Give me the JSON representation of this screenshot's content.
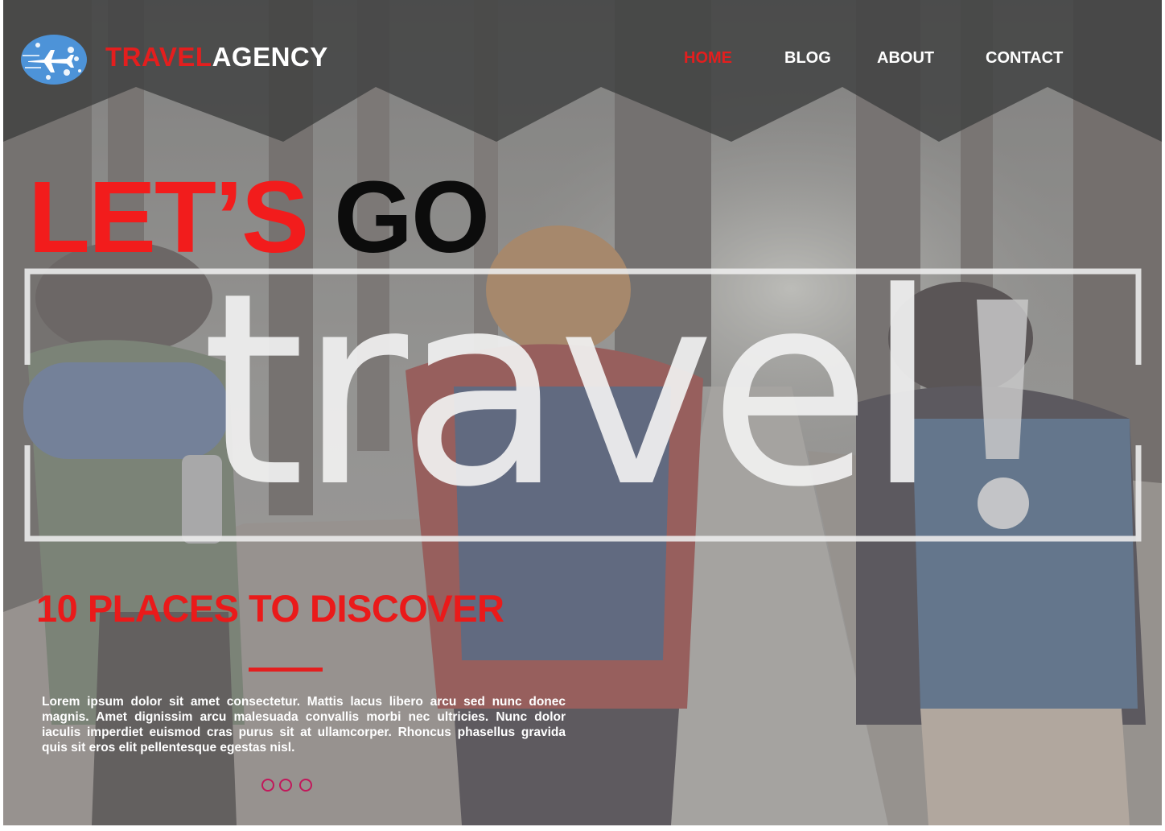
{
  "brand": {
    "part1": "TRAVEL",
    "part2": "AGENCY",
    "logo_icon": "airplane-over-globe-icon"
  },
  "nav": {
    "items": [
      {
        "label": "HOME",
        "active": true
      },
      {
        "label": "BLOG",
        "active": false
      },
      {
        "label": "ABOUT",
        "active": false
      },
      {
        "label": "CONTACT",
        "active": false
      }
    ]
  },
  "hero": {
    "headline_red": "LET’S",
    "headline_black": "GO",
    "big_word": "travel",
    "big_word_punct": "!",
    "subtitle": "10 PLACES TO DISCOVER",
    "body": "Lorem ipsum dolor sit amet consectetur. Mattis lacus libero arcu sed nunc donec magnis. Amet dignissim arcu malesuada convallis morbi nec ultricies. Nunc dolor iaculis imperdiet euismod cras purus sit at ullamcorper. Rhoncus phasellus gravida quis sit eros elit pellentesque egestas nisl."
  },
  "carousel": {
    "count": 3
  },
  "colors": {
    "accent": "#e41e1e",
    "header_band": "#4f5151",
    "dot": "#c2185b"
  }
}
